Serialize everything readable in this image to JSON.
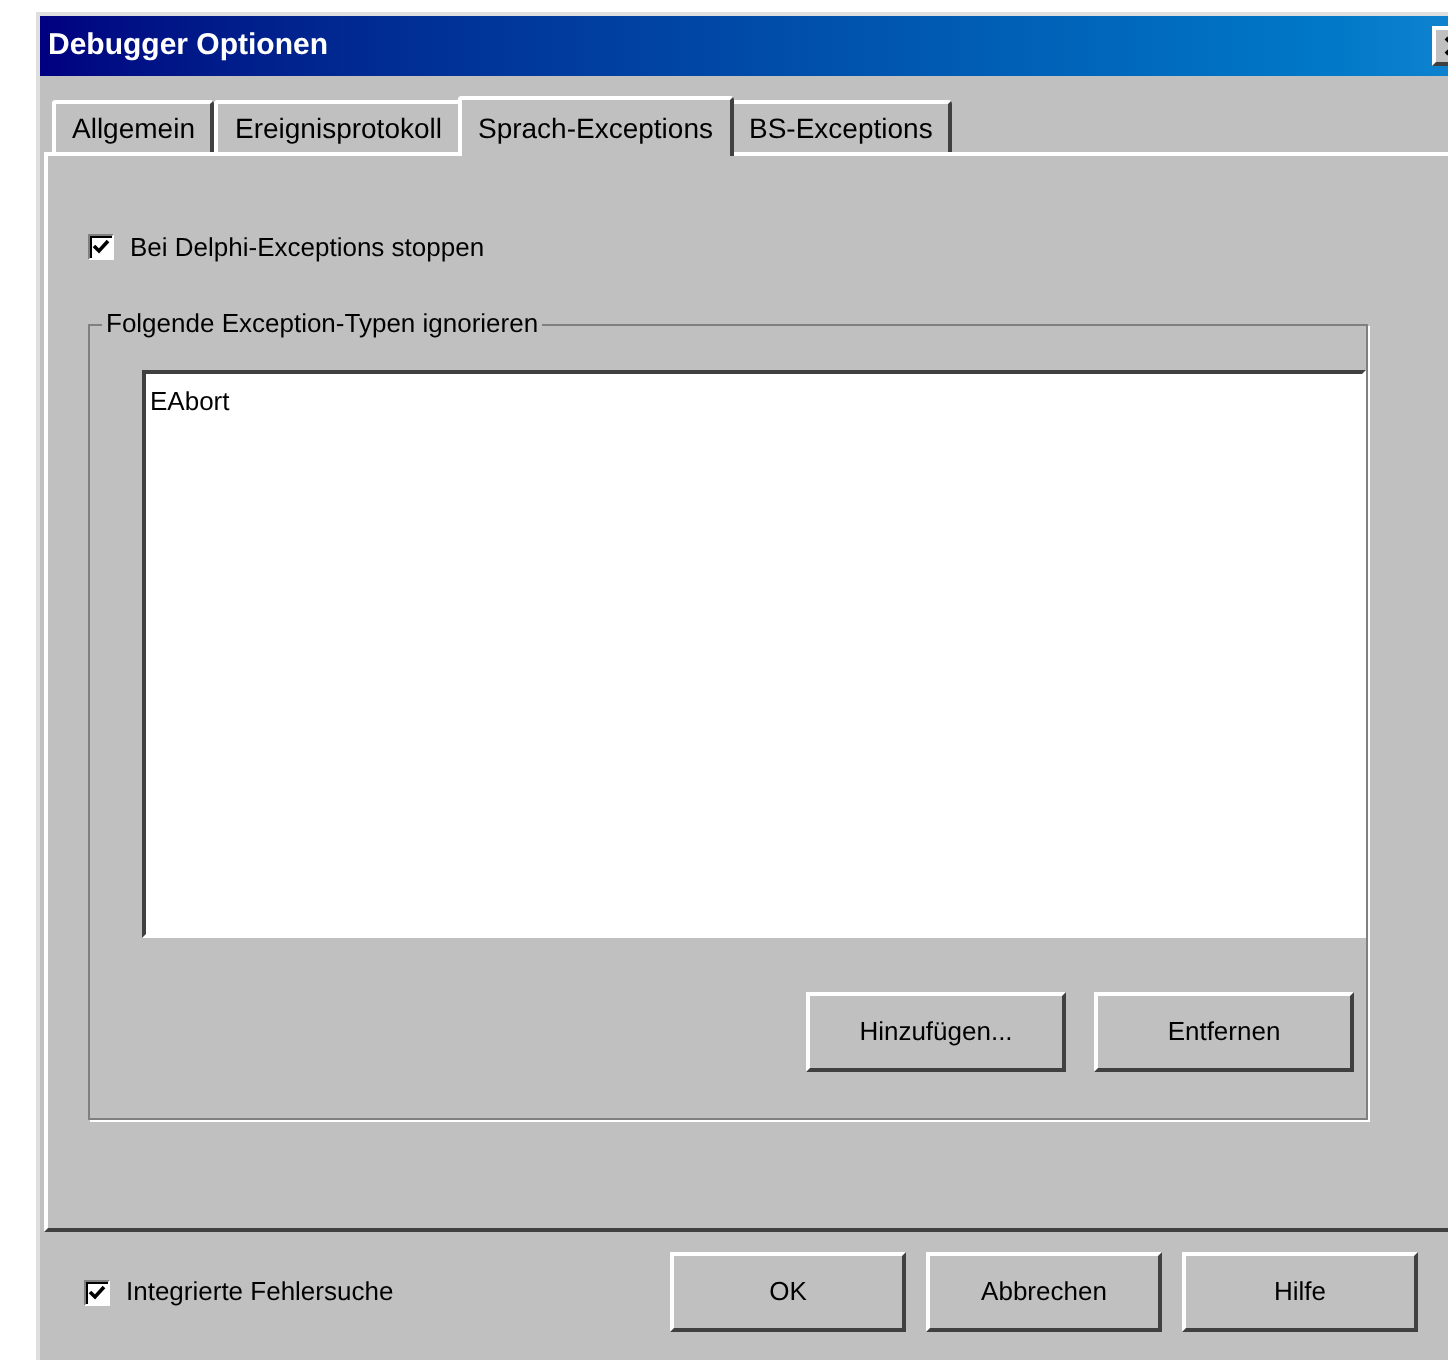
{
  "window": {
    "title": "Debugger Optionen"
  },
  "tabs": [
    {
      "label": "Allgemein",
      "selected": false
    },
    {
      "label": "Ereignisprotokoll",
      "selected": false
    },
    {
      "label": "Sprach-Exceptions",
      "selected": true
    },
    {
      "label": "BS-Exceptions",
      "selected": false
    }
  ],
  "stop_checkbox": {
    "label": "Bei Delphi-Exceptions stoppen",
    "checked": true
  },
  "group": {
    "title": "Folgende Exception-Typen ignorieren",
    "items": [
      "EAbort"
    ]
  },
  "group_buttons": [
    "Hinzufügen...",
    "Entfernen"
  ],
  "integrated_checkbox": {
    "label": "Integrierte Fehlersuche",
    "checked": true
  },
  "buttons": [
    "OK",
    "Abbrechen",
    "Hilfe"
  ]
}
